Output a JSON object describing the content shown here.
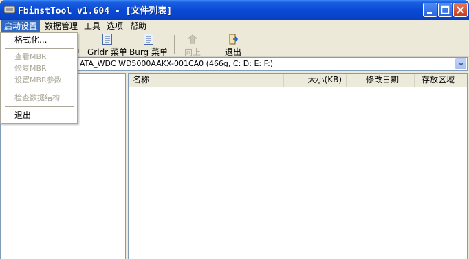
{
  "window": {
    "title": "FbinstTool v1.604 - [文件列表]",
    "icons": {
      "app": "app-icon",
      "minimize": "minimize-icon",
      "maximize": "maximize-icon",
      "close": "close-icon"
    }
  },
  "menubar": {
    "items": [
      {
        "label": "启动设置",
        "active": true
      },
      {
        "label": "数据管理"
      },
      {
        "label": "工具"
      },
      {
        "label": "选项"
      },
      {
        "label": "帮助"
      }
    ]
  },
  "toolbar": {
    "partial_label": "单",
    "grldr_label": "Grldr 菜单",
    "burg_label": "Burg 菜单",
    "up_label": "向上",
    "exit_label": "退出"
  },
  "disk": {
    "selected": "ATA_WDC WD5000AAKX-001CA0 (466g, C: D: E: F:)"
  },
  "file_list": {
    "columns": [
      "名称",
      "大小(KB)",
      "修改日期",
      "存放区域"
    ]
  },
  "start_menu": {
    "items": [
      {
        "label": "格式化...",
        "enabled": true
      },
      {
        "label": "查看MBR",
        "enabled": false
      },
      {
        "label": "修复MBR",
        "enabled": false
      },
      {
        "label": "设置MBR参数",
        "enabled": false
      },
      {
        "label": "检查数据结构",
        "enabled": false
      },
      {
        "label": "退出",
        "enabled": true
      }
    ]
  },
  "colors": {
    "titlebar": "#0a4ad6",
    "menu_highlight": "#316ac5",
    "disabled_text": "#aca899"
  }
}
